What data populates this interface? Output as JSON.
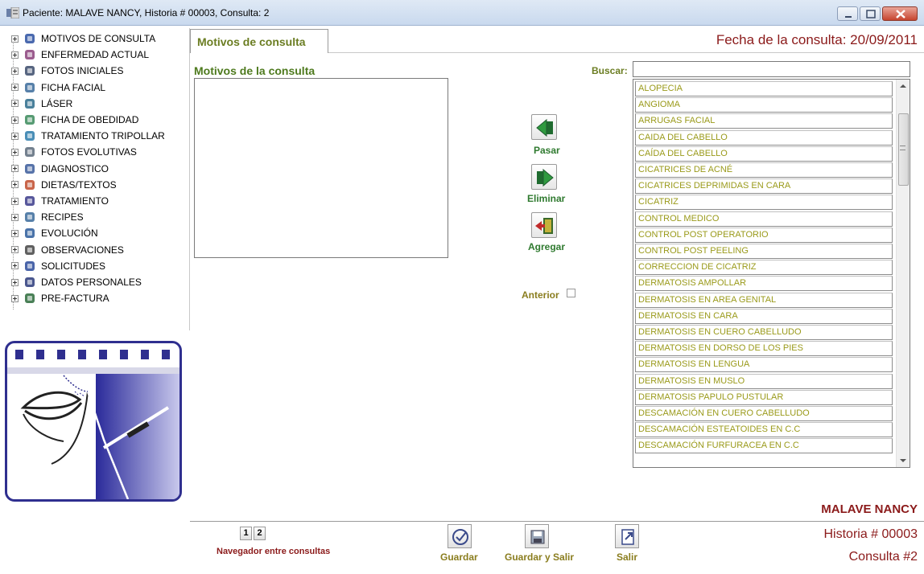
{
  "window": {
    "title": "Paciente: MALAVE  NANCY, Historia # 00003, Consulta: 2"
  },
  "tree": {
    "items": [
      {
        "label": "MOTIVOS DE CONSULTA",
        "icon": "wheelchair-icon"
      },
      {
        "label": "ENFERMEDAD ACTUAL",
        "icon": "person-icon"
      },
      {
        "label": "FOTOS INICIALES",
        "icon": "photo-icon"
      },
      {
        "label": "FICHA FACIAL",
        "icon": "smiley-icon"
      },
      {
        "label": "LÁSER",
        "icon": "laser-icon"
      },
      {
        "label": "FICHA DE OBEDIDAD",
        "icon": "scale-icon"
      },
      {
        "label": "TRATAMIENTO TRIPOLLAR",
        "icon": "device-icon"
      },
      {
        "label": "FOTOS EVOLUTIVAS",
        "icon": "photos-icon"
      },
      {
        "label": "DIAGNOSTICO",
        "icon": "pencil-icon"
      },
      {
        "label": "DIETAS/TEXTOS",
        "icon": "apple-icon"
      },
      {
        "label": "TRATAMIENTO",
        "icon": "treatment-icon"
      },
      {
        "label": "RECIPES",
        "icon": "recipe-icon"
      },
      {
        "label": "EVOLUCIÓN",
        "icon": "evolution-icon"
      },
      {
        "label": "OBSERVACIONES",
        "icon": "observations-icon"
      },
      {
        "label": "SOLICITUDES",
        "icon": "requests-icon"
      },
      {
        "label": "DATOS PERSONALES",
        "icon": "info-icon"
      },
      {
        "label": "PRE-FACTURA",
        "icon": "invoice-icon"
      }
    ]
  },
  "tab": {
    "label": "Motivos de consulta"
  },
  "fecha": "Fecha de la consulta:  20/09/2011",
  "motivos": {
    "label": "Motivos de la consulta",
    "value": ""
  },
  "buscar": {
    "label": "Buscar:",
    "value": ""
  },
  "list": {
    "items": [
      "ALOPECIA",
      "ANGIOMA",
      "ARRUGAS FACIAL",
      "CAIDA DEL CABELLO",
      "CAÍDA DEL CABELLO",
      "CICATRICES DE ACNÉ",
      "CICATRICES DEPRIMIDAS EN CARA",
      "CICATRIZ",
      "CONTROL MEDICO",
      "CONTROL POST OPERATORIO",
      "CONTROL POST PEELING",
      "CORRECCION DE CICATRIZ",
      "DERMATOSIS AMPOLLAR",
      "DERMATOSIS EN AREA GENITAL",
      "DERMATOSIS EN CARA",
      "DERMATOSIS EN CUERO CABELLUDO",
      "DERMATOSIS EN DORSO DE LOS PIES",
      "DERMATOSIS EN LENGUA",
      "DERMATOSIS EN MUSLO",
      "DERMATOSIS PAPULO PUSTULAR",
      "DESCAMACIÓN EN CUERO CABELLUDO",
      "DESCAMACIÓN ESTEATOIDES EN C.C",
      "DESCAMACIÓN FURFURACEA EN C.C"
    ]
  },
  "actions": {
    "pasar": "Pasar",
    "eliminar": "Eliminar",
    "agregar": "Agregar",
    "anterior": "Anterior"
  },
  "navigator": {
    "pages": [
      "1",
      "2"
    ],
    "label": "Navegador entre consultas"
  },
  "bottom_buttons": {
    "guardar": "Guardar",
    "guardar_salir": "Guardar y Salir",
    "salir": "Salir"
  },
  "patient": {
    "name": "MALAVE NANCY",
    "historia": "Historia # 00003",
    "consulta": "Consulta #2"
  },
  "colors": {
    "accent_green": "#6b7d22",
    "dark_red": "#8b1a1a",
    "list_text": "#9a9a1a",
    "logo_blue": "#2f2f8f"
  }
}
